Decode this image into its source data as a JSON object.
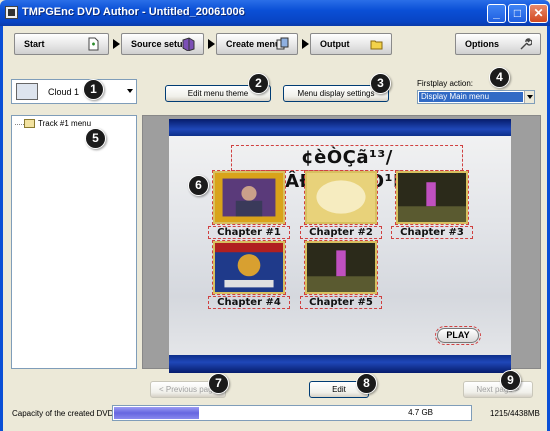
{
  "window": {
    "title": "TMPGEnc DVD Author - Untitled_20061006",
    "minimize_glyph": "_",
    "maximize_glyph": "□",
    "close_glyph": "✕"
  },
  "steps": {
    "start": "Start",
    "source_setup": "Source setup",
    "create_menu": "Create menu",
    "output": "Output",
    "options": "Options"
  },
  "theme": {
    "selected": "Cloud 1"
  },
  "buttons": {
    "edit_menu_theme": "Edit menu theme",
    "menu_display_settings": "Menu display settings",
    "previous_page": "< Previous page",
    "edit": "Edit",
    "next_page": "Next page >"
  },
  "firstplay": {
    "label": "Firstplay action:",
    "value": "Display Main menu"
  },
  "tree": {
    "items": [
      "Track #1 menu"
    ]
  },
  "menu_preview": {
    "title": "¢èÒÇã¹³/₄ÂÐÃÒªÊÓ¹Ñ¡",
    "chapters": [
      "Chapter #1",
      "Chapter #2",
      "Chapter #3",
      "Chapter #4",
      "Chapter #5"
    ],
    "play_label": "PLAY"
  },
  "capacity": {
    "label": "Capacity of the created DVD:",
    "fill_fraction": 0.24,
    "bar_text": "4.7 GB",
    "usage": "1215/4438MB"
  },
  "badges": [
    "1",
    "2",
    "3",
    "4",
    "5",
    "6",
    "7",
    "8",
    "9"
  ]
}
